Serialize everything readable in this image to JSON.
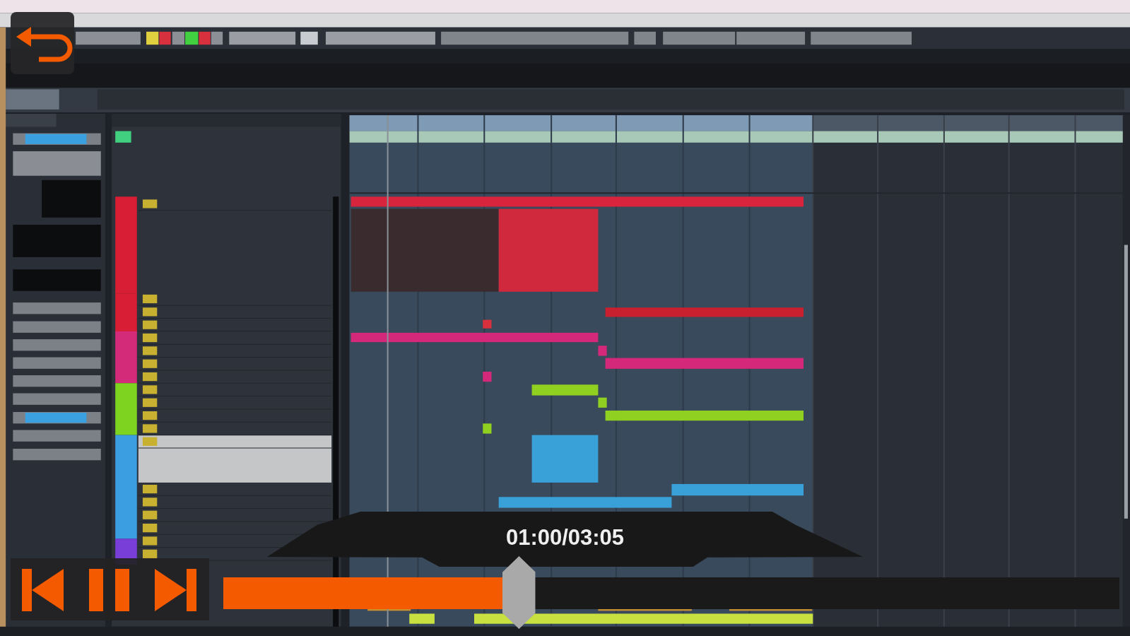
{
  "player": {
    "playing": true,
    "time": "01:00/03:05",
    "progress": {
      "level": 0.33
    }
  }
}
